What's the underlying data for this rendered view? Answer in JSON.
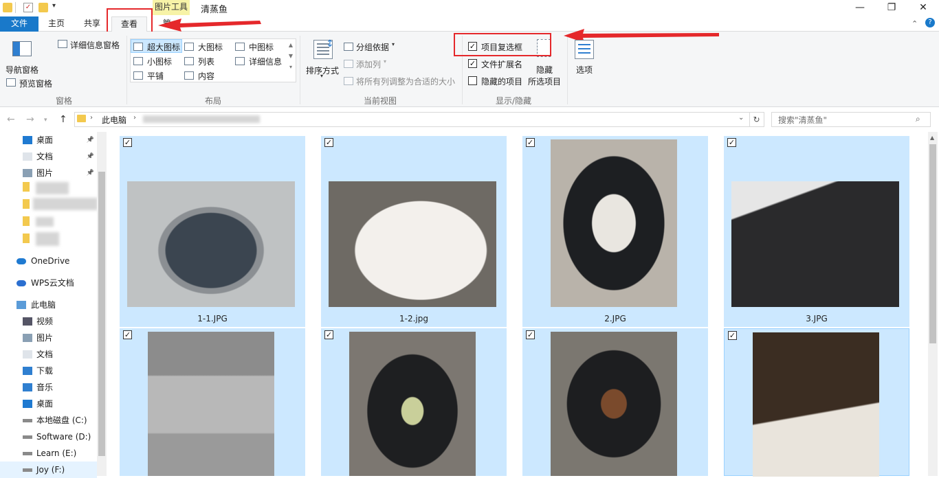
{
  "window": {
    "context_tab": "图片工具",
    "title": "清蒸鱼",
    "min": "—",
    "max": "❐",
    "close": "✕"
  },
  "tabs": {
    "file": "文件",
    "home": "主页",
    "share": "共享",
    "view": "查看",
    "manage": "管"
  },
  "ribbon": {
    "panes": {
      "nav_pane": "导航窗格",
      "preview_pane": "预览窗格",
      "details_pane": "详细信息窗格",
      "title": "窗格"
    },
    "layout": {
      "xl_icons": "超大图标",
      "large_icons": "大图标",
      "medium_icons": "中图标",
      "small_icons": "小图标",
      "list": "列表",
      "details": "详细信息",
      "tiles": "平铺",
      "content": "内容",
      "title": "布局"
    },
    "current_view": {
      "sort_by": "排序方式",
      "group_by": "分组依据",
      "add_columns": "添加列",
      "size_all": "将所有列调整为合适的大小",
      "title": "当前视图"
    },
    "show_hide": {
      "item_checkboxes": "项目复选框",
      "item_checkboxes_checked": true,
      "file_ext": "文件扩展名",
      "file_ext_checked": true,
      "hidden_items": "隐藏的项目",
      "hidden_items_checked": false,
      "hide_selected_1": "隐藏",
      "hide_selected_2": "所选项目",
      "title": "显示/隐藏"
    },
    "options": "选项"
  },
  "address": {
    "crumb": "此电脑",
    "search_placeholder": "搜索\"清蒸鱼\""
  },
  "sidebar": {
    "items": [
      {
        "label": "桌面",
        "icon": "desktop-icon",
        "pinned": true
      },
      {
        "label": "文档",
        "icon": "documents-icon",
        "pinned": true
      },
      {
        "label": "图片",
        "icon": "pictures-icon",
        "pinned": true
      },
      {
        "label": "OneDrive",
        "icon": "onedrive-icon"
      },
      {
        "label": "WPS云文档",
        "icon": "wps-cloud-icon"
      },
      {
        "label": "此电脑",
        "icon": "this-pc-icon"
      },
      {
        "label": "视频",
        "icon": "videos-icon"
      },
      {
        "label": "图片",
        "icon": "pictures-icon"
      },
      {
        "label": "文档",
        "icon": "documents-icon"
      },
      {
        "label": "下载",
        "icon": "downloads-icon"
      },
      {
        "label": "音乐",
        "icon": "music-icon"
      },
      {
        "label": "桌面",
        "icon": "desktop-icon"
      },
      {
        "label": "本地磁盘 (C:)",
        "icon": "drive-icon"
      },
      {
        "label": "Software (D:)",
        "icon": "drive-icon"
      },
      {
        "label": "Learn (E:)",
        "icon": "drive-icon"
      },
      {
        "label": "Joy (F:)",
        "icon": "drive-icon"
      }
    ]
  },
  "files": [
    {
      "name": "1-1.JPG",
      "checked": true
    },
    {
      "name": "1-2.jpg",
      "checked": true
    },
    {
      "name": "2.JPG",
      "checked": true
    },
    {
      "name": "3.JPG",
      "checked": true
    },
    {
      "name": "",
      "checked": true
    },
    {
      "name": "",
      "checked": true
    },
    {
      "name": "",
      "checked": true
    },
    {
      "name": "",
      "checked": true
    }
  ],
  "colors": {
    "accent": "#1979ca",
    "selection": "#cce8ff",
    "annotation": "#e5282b"
  }
}
